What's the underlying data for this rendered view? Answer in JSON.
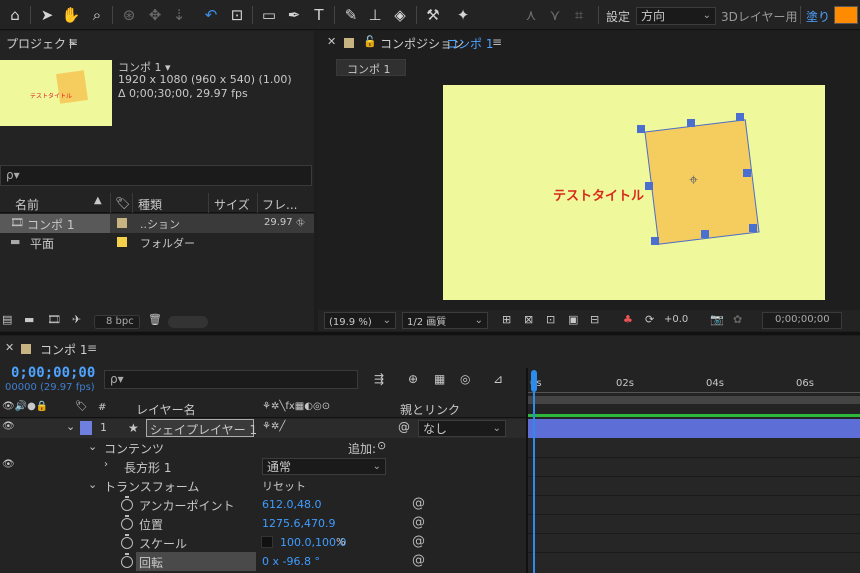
{
  "toolbar": {
    "settings_label": "設定",
    "orient_value": "方向",
    "layer3d_label": "3Dレイヤー用",
    "fill_label": "塗り :",
    "fill_color": "#ff8c00"
  },
  "project": {
    "title": "プロジェクト",
    "comp_name": "コンポ 1 ▾",
    "comp_size": "1920 x 1080  (960 x 540) (1.00)",
    "comp_duration": "Δ 0;00;30;00, 29.97 fps",
    "thumb_text": "テストタイトル",
    "search_placeholder": "ρ▾",
    "col_name": "名前",
    "col_type": "種類",
    "col_size": "サイズ",
    "col_frame": "フレ...",
    "items": [
      {
        "name": "コンポ 1",
        "type": "..ション",
        "frame": "29.97",
        "color": "#c7b482"
      },
      {
        "name": "平面",
        "type": "フォルダー",
        "frame": "",
        "color": "#f5d04a"
      }
    ],
    "bpc": "8 bpc"
  },
  "comp_viewer": {
    "title": "コンポジション",
    "comp_link": "コンポ 1",
    "tab": "コンポ 1",
    "canvas_text": "テストタイトル",
    "bg_color": "#eff89a",
    "shape_color": "#f5cc5e",
    "zoom": "(19.9 %)",
    "resolution": "1/2 画質",
    "exposure": "+0.0",
    "timecode": "0;00;00;00"
  },
  "timeline": {
    "tab": "コンポ 1",
    "timecode": "0;00;00;00",
    "frame_info": "00000 (29.97 fps)",
    "search_placeholder": "ρ▾",
    "col_layer_name": "レイヤー名",
    "col_parent": "親とリンク",
    "ruler": [
      "0s",
      "02s",
      "04s",
      "06s"
    ],
    "layer": {
      "num": "1",
      "name": "シェイプレイヤー 1",
      "parent": "なし",
      "color": "#6f7fe0"
    },
    "contents_label": "コンテンツ",
    "add_label": "追加:",
    "rect_label": "長方形 1",
    "blend_value": "通常",
    "transform_label": "トランスフォーム",
    "reset_label": "リセット",
    "props": [
      {
        "name": "アンカーポイント",
        "value": "612.0,48.0"
      },
      {
        "name": "位置",
        "value": "1275.6,470.9"
      },
      {
        "name": "スケール",
        "value": "100.0,100.0",
        "unit": "%"
      },
      {
        "name": "回転",
        "value": "0 x -96.8 °"
      }
    ]
  }
}
